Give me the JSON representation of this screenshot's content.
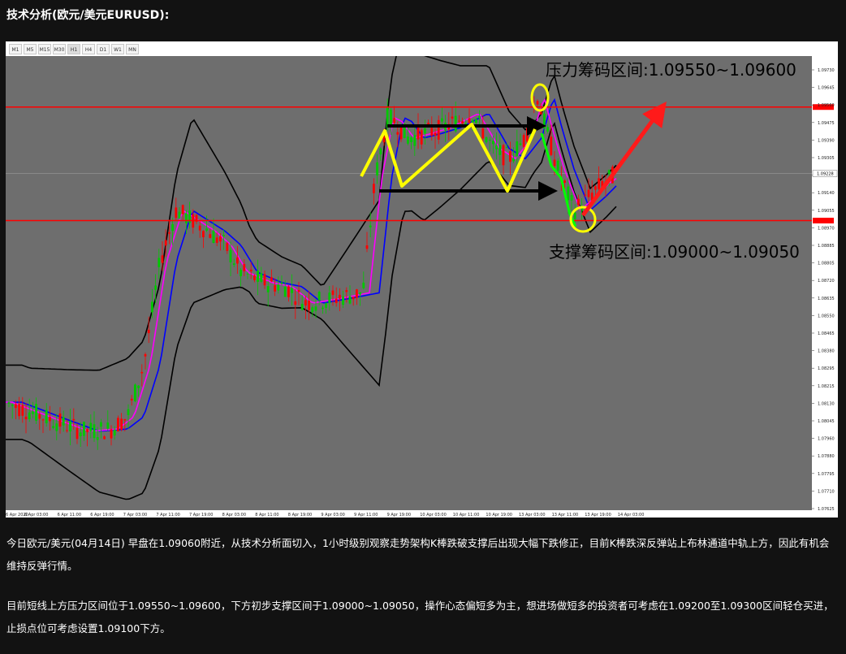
{
  "title": "技术分析(欧元/美元EURUSD):",
  "timeframes": [
    "M1",
    "M5",
    "M15",
    "M30",
    "H1",
    "H4",
    "D1",
    "W1",
    "MN"
  ],
  "active_timeframe": "H1",
  "chart_data": {
    "type": "candlestick",
    "symbol": "EURUSD",
    "y_axis_labels": [
      "1.09730",
      "1.09645",
      "1.09560",
      "1.09475",
      "1.09390",
      "1.09305",
      "1.09228",
      "1.09140",
      "1.09055",
      "1.08970",
      "1.08885",
      "1.08805",
      "1.08720",
      "1.08635",
      "1.08550",
      "1.08465",
      "1.08380",
      "1.08295",
      "1.08215",
      "1.08130",
      "1.08045",
      "1.07960",
      "1.07880",
      "1.07795",
      "1.07710",
      "1.07625"
    ],
    "x_axis_labels": [
      "6 Apr 2020",
      "6 Apr 03:00",
      "6 Apr 11:00",
      "6 Apr 19:00",
      "7 Apr 03:00",
      "7 Apr 11:00",
      "7 Apr 19:00",
      "8 Apr 03:00",
      "8 Apr 11:00",
      "8 Apr 19:00",
      "9 Apr 03:00",
      "9 Apr 11:00",
      "9 Apr 19:00",
      "10 Apr 03:00",
      "10 Apr 11:00",
      "10 Apr 19:00",
      "13 Apr 03:00",
      "13 Apr 11:00",
      "13 Apr 19:00",
      "14 Apr 03:00"
    ],
    "current_price": "1.09228",
    "resistance_line": "1.09550",
    "support_line": "1.09000",
    "annotations": {
      "resistance": "压力筹码区间:1.09550~1.09600",
      "support": "支撑筹码区间:1.09000~1.09050"
    },
    "colors": {
      "bull": "#00c800",
      "bear": "#ff0000",
      "background": "#6e6e6e",
      "bollinger": "#000000",
      "ma_fast": "#ff00ff",
      "ma_slow": "#0000ff",
      "levels": "#ff0000",
      "zigzag": "#ffff00"
    }
  },
  "paragraphs": [
    "今日欧元/美元(04月14日) 早盘在1.09060附近，从技术分析面切入，1小时级别观察走势架构K棒跌破支撑后出现大幅下跌修正，目前K棒跌深反弹站上布林通道中轨上方，因此有机会维持反弹行情。",
    "目前短线上方压力区间位于1.09550~1.09600，下方初步支撑区间于1.09000~1.09050，操作心态偏短多为主，想进场做短多的投资者可考虑在1.09200至1.09300区间轻仓买进，止损点位可考虑设置1.09100下方。"
  ]
}
